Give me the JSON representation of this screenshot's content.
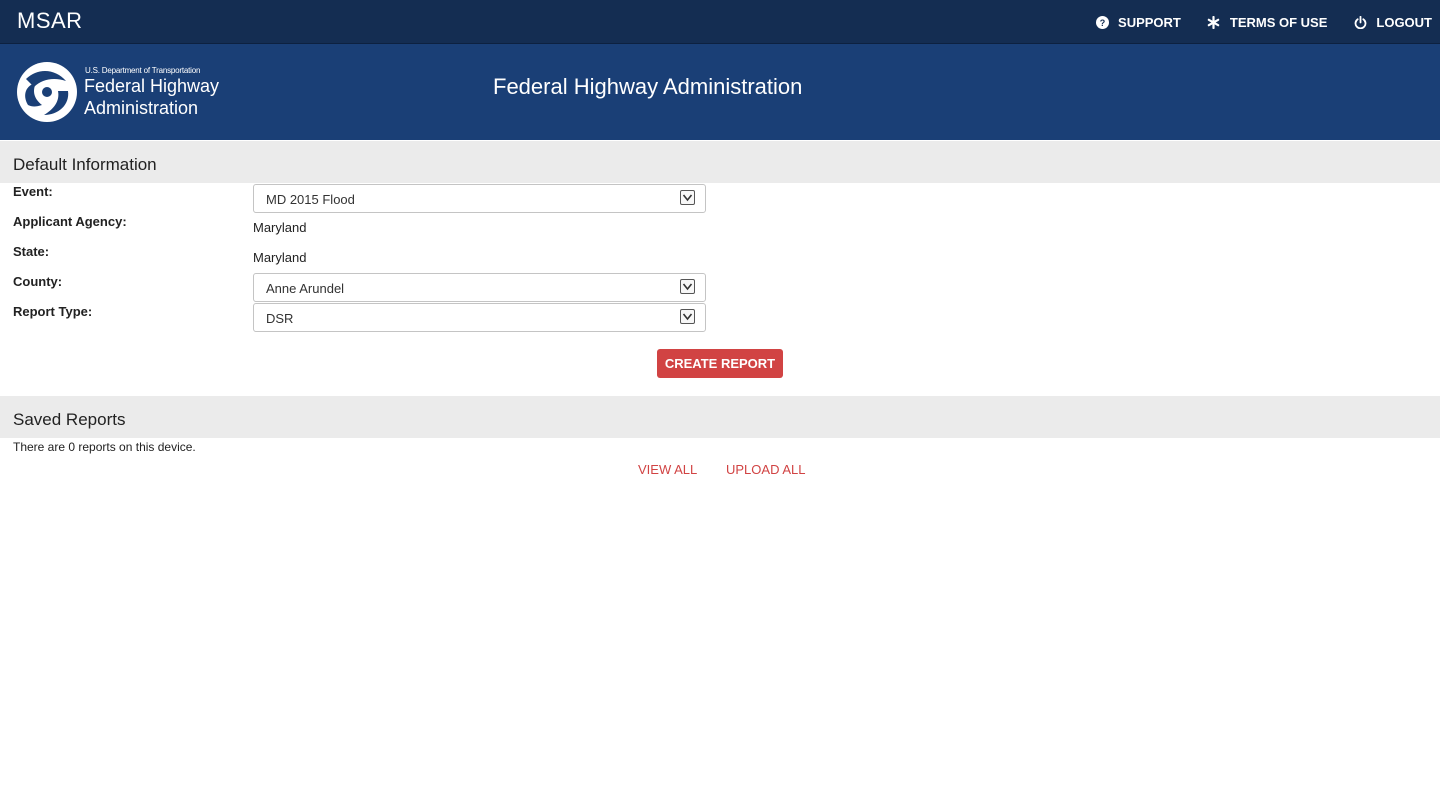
{
  "app": {
    "title": "MSAR"
  },
  "topnav": {
    "items": [
      {
        "label": "SUPPORT",
        "icon": "question-circle-icon"
      },
      {
        "label": "TERMS OF USE",
        "icon": "asterisk-icon"
      },
      {
        "label": "LOGOUT",
        "icon": "power-icon"
      }
    ]
  },
  "banner": {
    "logo_dept": "U.S. Department of Transportation",
    "logo_line1": "Federal Highway",
    "logo_line2": "Administration",
    "title": "Federal Highway Administration"
  },
  "default_info": {
    "heading": "Default Information",
    "event_label": "Event:",
    "event_value": "MD 2015 Flood",
    "agency_label": "Applicant Agency:",
    "agency_value": "Maryland",
    "state_label": "State:",
    "state_value": "Maryland",
    "county_label": "County:",
    "county_value": "Anne Arundel",
    "report_type_label": "Report Type:",
    "report_type_value": "DSR",
    "create_button": "CREATE REPORT"
  },
  "saved_reports": {
    "heading": "Saved Reports",
    "info": "There are 0 reports on this device.",
    "view_all": "VIEW ALL",
    "upload_all": "UPLOAD ALL"
  },
  "colors": {
    "topbar": "#142d52",
    "banner": "#1a3f76",
    "accent": "#d14343",
    "section_bg": "#ebebeb"
  }
}
